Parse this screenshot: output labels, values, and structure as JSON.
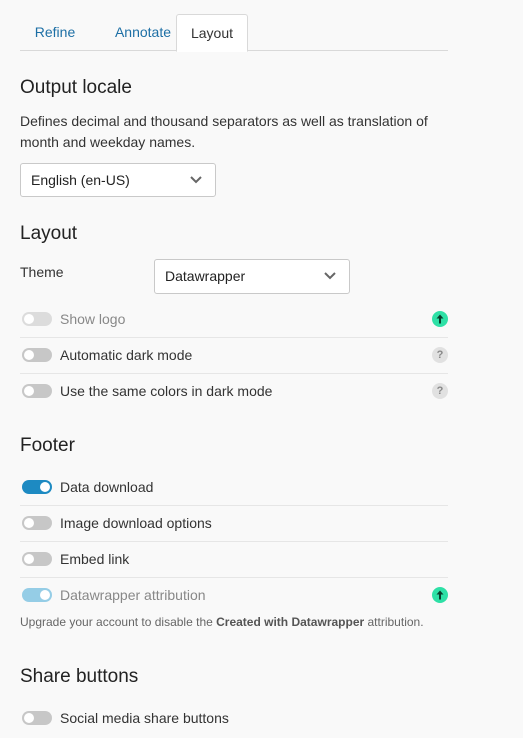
{
  "tabs": [
    {
      "label": "Refine"
    },
    {
      "label": "Annotate"
    },
    {
      "label": "Layout"
    }
  ],
  "output_locale": {
    "heading": "Output locale",
    "description": "Defines decimal and thousand separators as well as translation of month and weekday names.",
    "selected": "English (en-US)"
  },
  "layout": {
    "heading": "Layout",
    "theme_label": "Theme",
    "theme_selected": "Datawrapper",
    "options": [
      {
        "label": "Show logo",
        "state": "disabled-off",
        "badge": "upgrade"
      },
      {
        "label": "Automatic dark mode",
        "state": "off",
        "badge": "help"
      },
      {
        "label": "Use the same colors in dark mode",
        "state": "off",
        "badge": "help"
      }
    ],
    "help_glyph": "?"
  },
  "footer": {
    "heading": "Footer",
    "options": [
      {
        "label": "Data download",
        "state": "on"
      },
      {
        "label": "Image download options",
        "state": "off"
      },
      {
        "label": "Embed link",
        "state": "off"
      },
      {
        "label": "Datawrapper attribution",
        "state": "disabled-on",
        "badge": "upgrade"
      }
    ],
    "note_prefix": "Upgrade your account to disable the ",
    "note_bold": "Created with Datawrapper",
    "note_suffix": " attribution."
  },
  "share": {
    "heading": "Share buttons",
    "options": [
      {
        "label": "Social media share buttons",
        "state": "off"
      }
    ]
  },
  "colors": {
    "accent": "#1d8ac2",
    "link": "#1d6fa5",
    "upgrade": "#2ee0a6"
  }
}
